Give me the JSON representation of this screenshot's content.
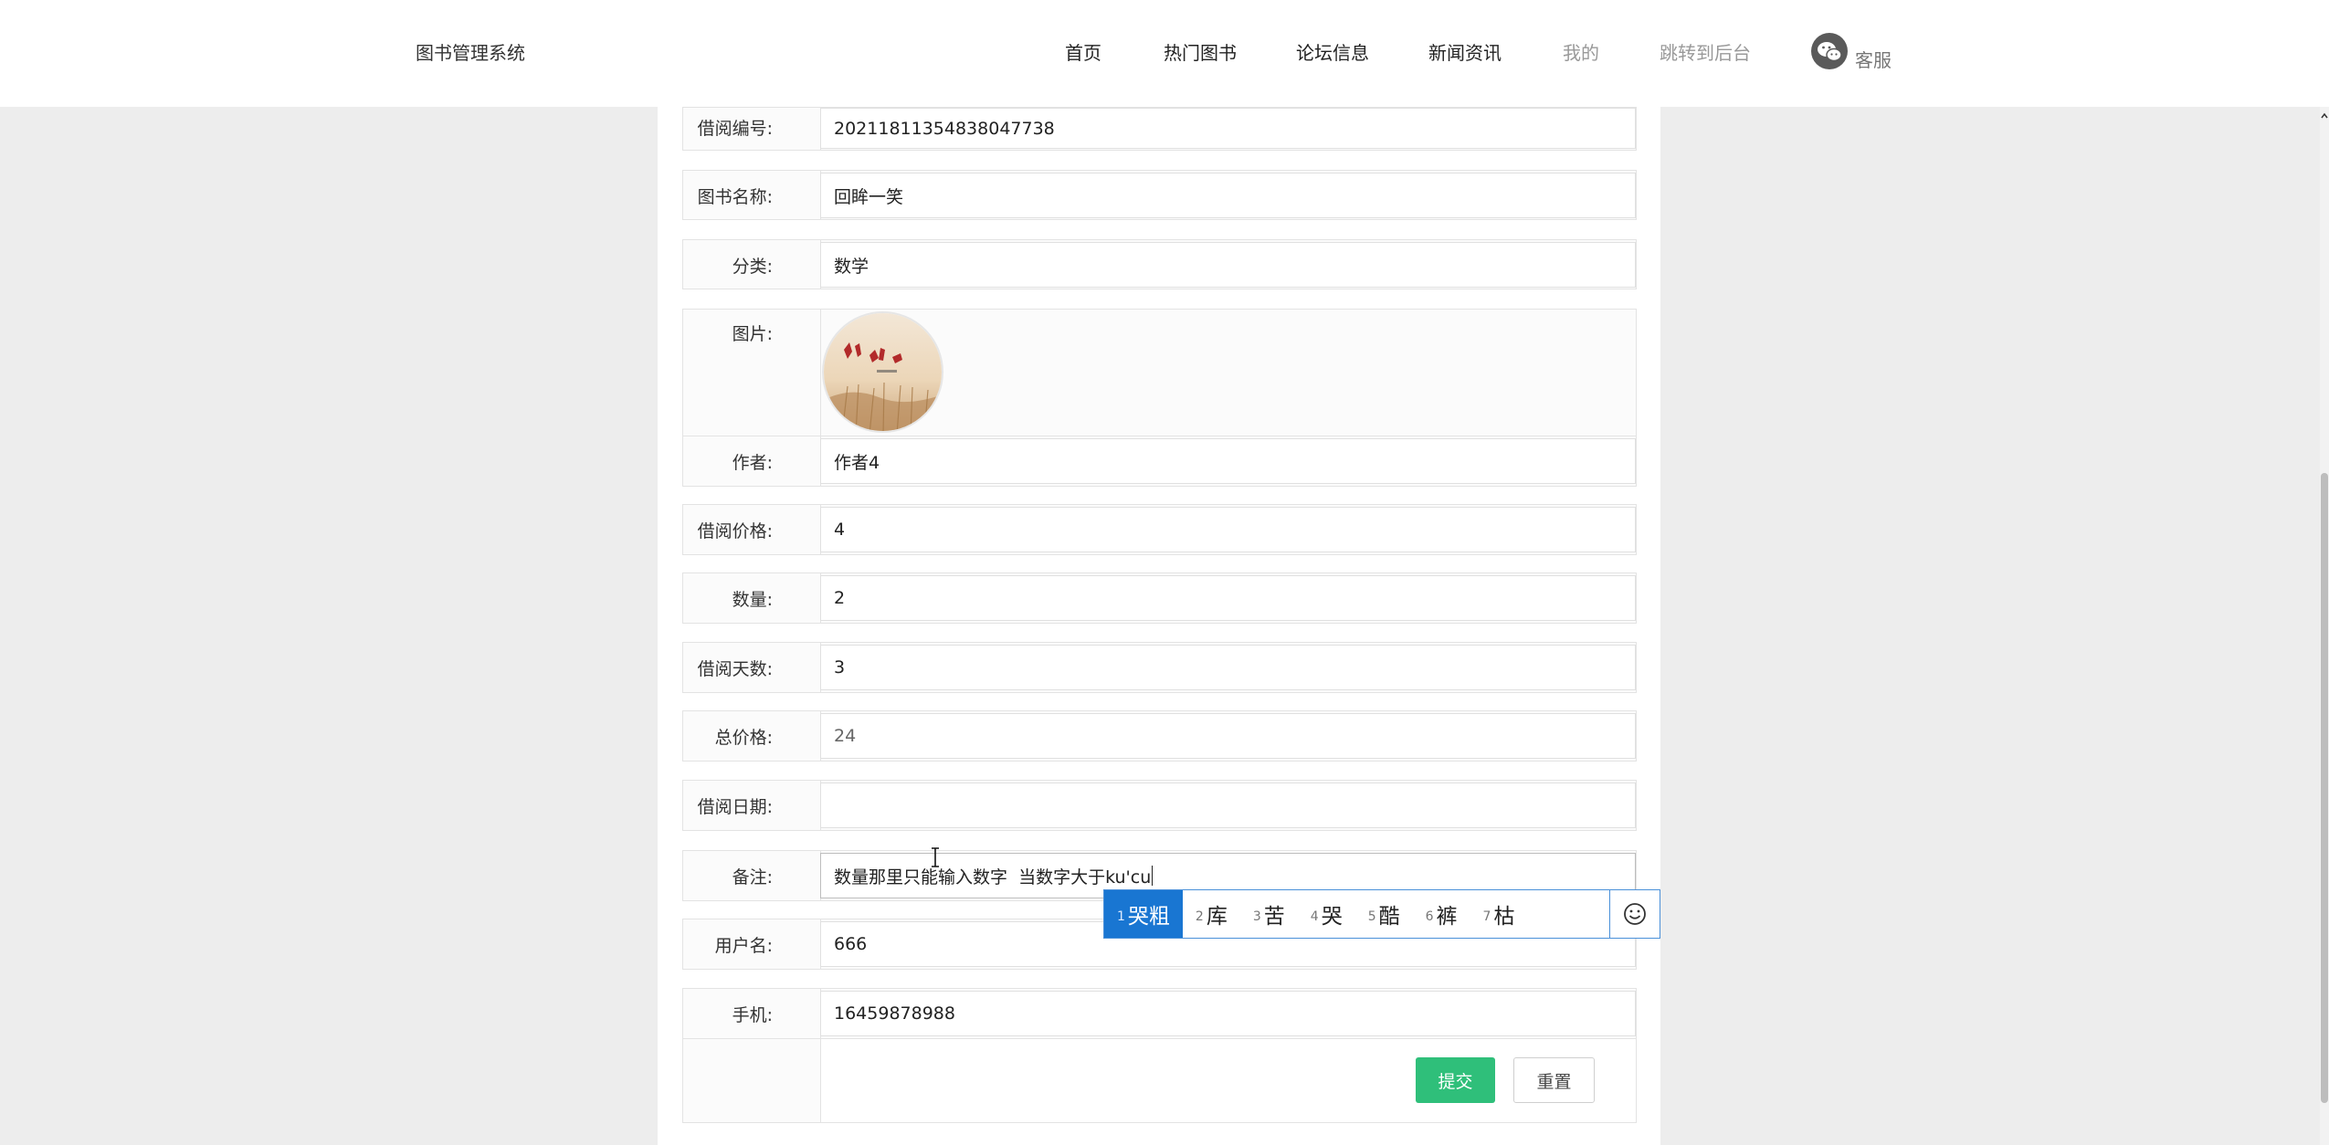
{
  "header": {
    "brand": "图书管理系统",
    "nav": [
      "首页",
      "热门图书",
      "论坛信息",
      "新闻资讯",
      "我的",
      "跳转到后台"
    ],
    "service_label": "客服"
  },
  "form": {
    "borrow_no_label": "借阅编号:",
    "borrow_no": "20211811354838047738",
    "book_name_label": "图书名称:",
    "book_name": "回眸一笑",
    "category_label": "分类:",
    "category": "数学",
    "image_label": "图片:",
    "author_label": "作者:",
    "author": "作者4",
    "price_label": "借阅价格:",
    "price": "4",
    "quantity_label": "数量:",
    "quantity": "2",
    "days_label": "借阅天数:",
    "days": "3",
    "total_label": "总价格:",
    "total": "24",
    "date_label": "借阅日期:",
    "date": "",
    "remark_label": "备注:",
    "remark": "数量那里只能输入数字  当数字大于ku'cu",
    "username_label": "用户名:",
    "username": "666",
    "phone_label": "手机:",
    "phone": "16459878988",
    "submit_label": "提交",
    "reset_label": "重置"
  },
  "ime": {
    "candidates": [
      {
        "num": "1",
        "text": "哭粗"
      },
      {
        "num": "2",
        "text": "库"
      },
      {
        "num": "3",
        "text": "苦"
      },
      {
        "num": "4",
        "text": "哭"
      },
      {
        "num": "5",
        "text": "酷"
      },
      {
        "num": "6",
        "text": "裤"
      },
      {
        "num": "7",
        "text": "枯"
      }
    ],
    "active_index": 0
  },
  "colors": {
    "accent_green": "#2fbf7a",
    "ime_active": "#1976d2"
  }
}
